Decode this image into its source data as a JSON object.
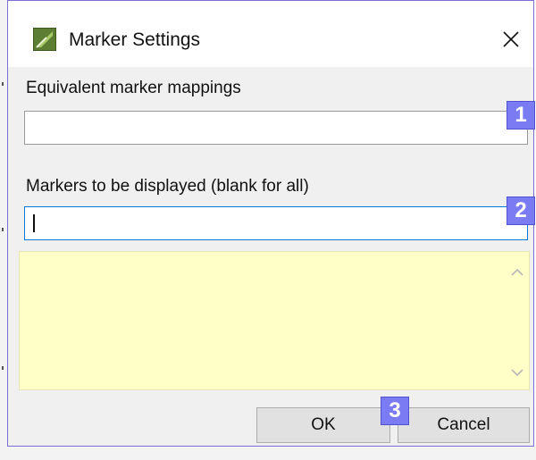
{
  "window": {
    "title": "Marker Settings",
    "icon": "app-logo-icon",
    "close_icon": "close-icon"
  },
  "equivalent_field": {
    "label": "Equivalent marker mappings",
    "value": "",
    "badge": "1"
  },
  "displayed_field": {
    "label": "Markers to be displayed (blank for all)",
    "value": "",
    "badge": "2"
  },
  "info_area": {
    "text": "",
    "background_color": "#ffffc8"
  },
  "buttons": {
    "ok_label": "OK",
    "cancel_label": "Cancel",
    "badge": "3"
  },
  "colors": {
    "badge": "#7b7cf4",
    "focus_border": "#0078d7"
  }
}
